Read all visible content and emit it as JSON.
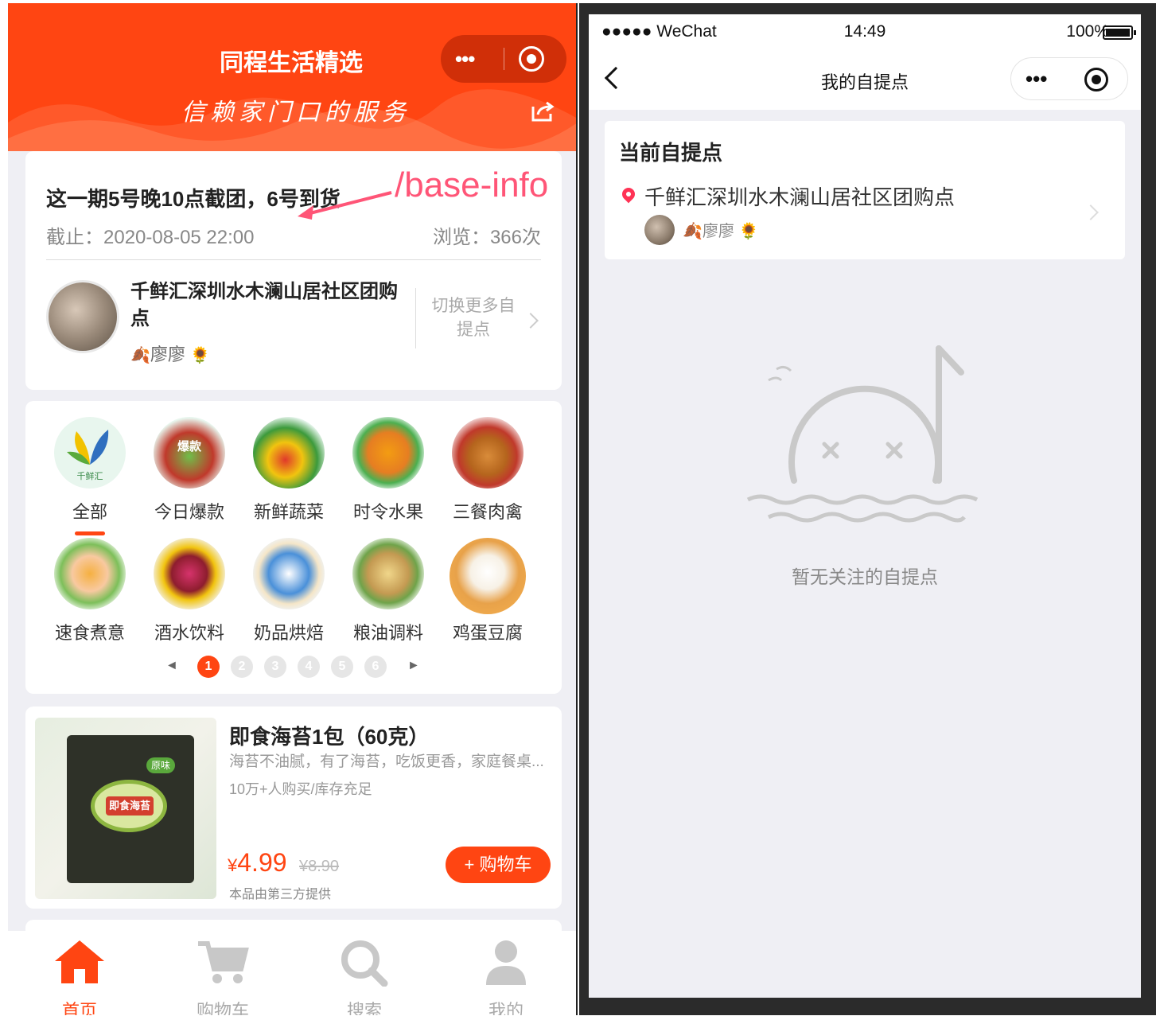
{
  "left": {
    "header": {
      "title": "同程生活精选",
      "slogan": "信赖家门口的服务",
      "capsule_more": "•••",
      "accent": "#ff4512"
    },
    "annotation": "/base-info",
    "info": {
      "notice": "这一期5号晚10点截团，6号到货",
      "deadline": "截止：2020-08-05 22:00",
      "views": "浏览：366次",
      "station_name": "千鲜汇深圳水木澜山居社区团购点",
      "leader": "廖廖",
      "switch_label": "切换更多自提点"
    },
    "categories": [
      {
        "label": "全部",
        "icon": "qianxianhui-logo-icon",
        "badge": "千鲜汇",
        "active": true
      },
      {
        "label": "今日爆款",
        "icon": "hot-deal-icon",
        "badge": "爆款"
      },
      {
        "label": "新鲜蔬菜",
        "icon": "vegetables-icon"
      },
      {
        "label": "时令水果",
        "icon": "fruits-icon"
      },
      {
        "label": "三餐肉禽",
        "icon": "meat-icon"
      },
      {
        "label": "速食煮意",
        "icon": "fast-food-icon"
      },
      {
        "label": "酒水饮料",
        "icon": "drinks-icon"
      },
      {
        "label": "奶品烘焙",
        "icon": "dairy-bakery-icon"
      },
      {
        "label": "粮油调料",
        "icon": "grain-oil-icon"
      },
      {
        "label": "鸡蛋豆腐",
        "icon": "egg-tofu-icon"
      }
    ],
    "pager": {
      "pages": [
        "1",
        "2",
        "3",
        "4",
        "5",
        "6"
      ],
      "current": 1,
      "prev": "◄",
      "next": "►"
    },
    "product": {
      "title": "即食海苔1包（60克）",
      "desc": "海苔不油腻，有了海苔，吃饭更香，家庭餐桌...",
      "sales": "10万+人购买/库存充足",
      "price_symbol": "¥",
      "price": "4.99",
      "original_price": "¥8.90",
      "provider": "本品由第三方提供",
      "cart_button": "+ 购物车",
      "package_badge": "原味",
      "package_label": "即食海苔"
    },
    "tabbar": [
      {
        "label": "首页",
        "icon": "home-icon",
        "active": true
      },
      {
        "label": "购物车",
        "icon": "cart-icon"
      },
      {
        "label": "搜索",
        "icon": "search-icon"
      },
      {
        "label": "我的",
        "icon": "profile-icon"
      }
    ]
  },
  "right": {
    "status": {
      "carrier": "●●●●● WeChat",
      "time": "14:49",
      "battery": "100%"
    },
    "nav": {
      "title": "我的自提点",
      "capsule_more": "•••"
    },
    "current": {
      "heading": "当前自提点",
      "station_name": "千鲜汇深圳水木澜山居社区团购点",
      "leader": "廖廖"
    },
    "empty_text": "暂无关注的自提点"
  }
}
